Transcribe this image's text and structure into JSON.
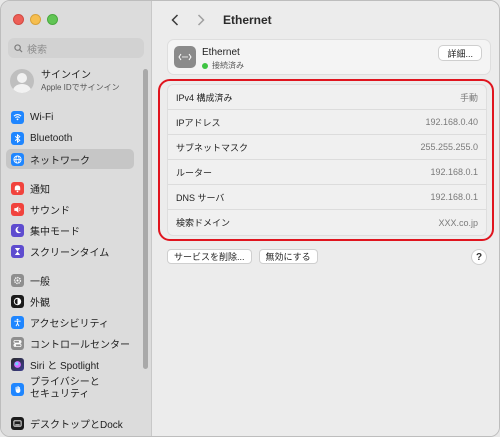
{
  "sidebar": {
    "search_placeholder": "検索",
    "account": {
      "name": "サインイン",
      "sub": "Apple IDでサインイン"
    },
    "groups": [
      [
        {
          "label": "Wi-Fi",
          "icon": "wifi-icon",
          "color": "#1f86ff"
        },
        {
          "label": "Bluetooth",
          "icon": "bluetooth-icon",
          "color": "#1f86ff"
        },
        {
          "label": "ネットワーク",
          "icon": "globe-icon",
          "color": "#1f86ff",
          "active": true
        }
      ],
      [
        {
          "label": "通知",
          "icon": "bell-icon",
          "color": "#f1433d"
        },
        {
          "label": "サウンド",
          "icon": "speaker-icon",
          "color": "#f1433d"
        },
        {
          "label": "集中モード",
          "icon": "moon-icon",
          "color": "#5e4ccf"
        },
        {
          "label": "スクリーンタイム",
          "icon": "hourglass-icon",
          "color": "#5e4ccf"
        }
      ],
      [
        {
          "label": "一般",
          "icon": "gear-icon",
          "color": "#8e8e8e"
        },
        {
          "label": "外観",
          "icon": "appearance-icon",
          "color": "#1b1b1b"
        },
        {
          "label": "アクセシビリティ",
          "icon": "accessibility-icon",
          "color": "#1f86ff"
        },
        {
          "label": "コントロールセンター",
          "icon": "control-center-icon",
          "color": "#8e8e8e"
        },
        {
          "label": "Siri と Spotlight",
          "icon": "siri-icon",
          "color": "#a244d8"
        },
        {
          "label": "プライバシーと\nセキュリティ",
          "icon": "hand-icon",
          "color": "#1f86ff"
        }
      ],
      [
        {
          "label": "デスクトップとDock",
          "icon": "desktop-icon",
          "color": "#1b1b1b"
        }
      ]
    ]
  },
  "toolbar": {
    "title": "Ethernet"
  },
  "service": {
    "name": "Ethernet",
    "status": "接続済み",
    "detail_button": "詳細..."
  },
  "details": [
    {
      "key": "IPv4 構成済み",
      "value": "手動"
    },
    {
      "key": "IPアドレス",
      "value": "192.168.0.40"
    },
    {
      "key": "サブネットマスク",
      "value": "255.255.255.0"
    },
    {
      "key": "ルーター",
      "value": "192.168.0.1"
    },
    {
      "key": "DNS サーバ",
      "value": "192.168.0.1"
    },
    {
      "key": "検索ドメイン",
      "value": "XXX.co.jp"
    }
  ],
  "buttons": {
    "delete_service": "サービスを削除...",
    "disable": "無効にする",
    "help": "?"
  },
  "colors": {
    "highlight": "#e0141e",
    "status_green": "#3ec442"
  }
}
